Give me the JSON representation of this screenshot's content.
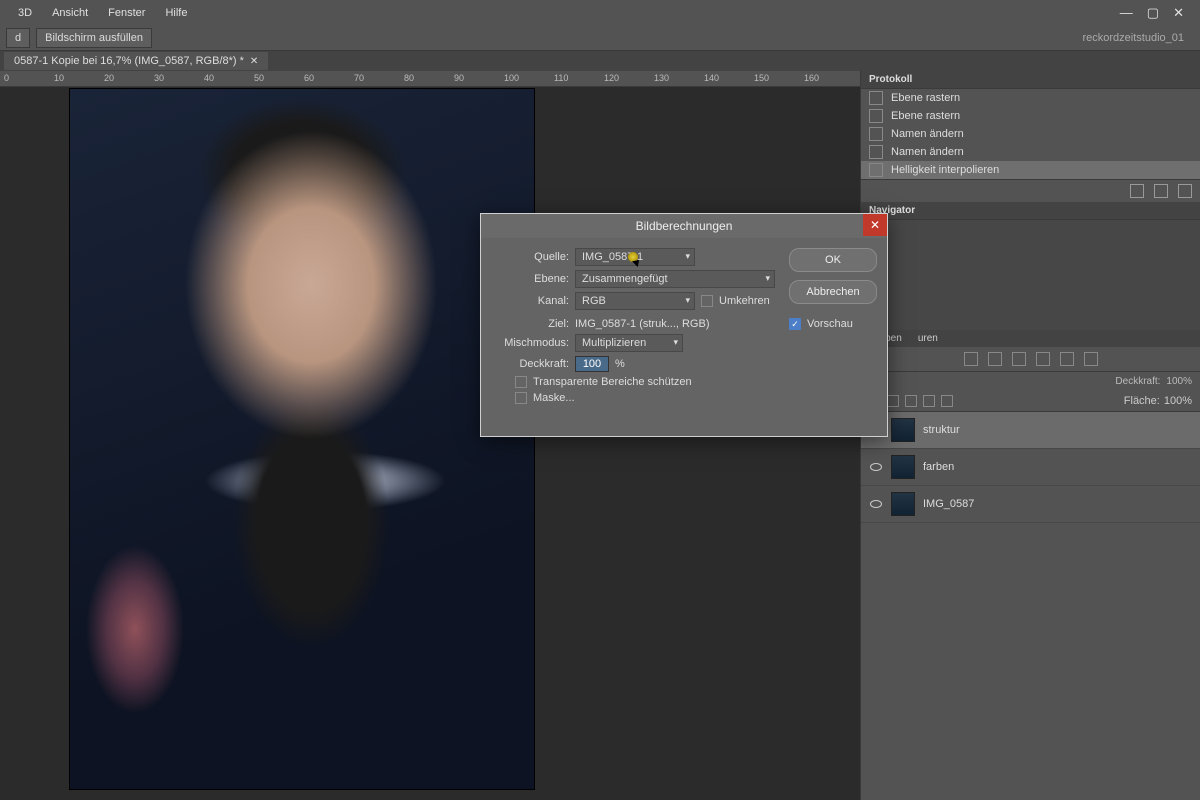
{
  "menubar": {
    "items": [
      "3D",
      "Ansicht",
      "Fenster",
      "Hilfe"
    ]
  },
  "options": {
    "left_btn": "d",
    "fill_btn": "Bildschirm ausfüllen",
    "workspace": "reckordzeitstudio_01"
  },
  "document_tab": "0587-1 Kopie bei 16,7% (IMG_0587, RGB/8*) *",
  "ruler_marks": [
    "0",
    "10",
    "20",
    "30",
    "40",
    "50",
    "60",
    "70",
    "80",
    "90",
    "100",
    "110",
    "120",
    "130",
    "140",
    "150",
    "160"
  ],
  "dialog": {
    "title": "Bildberechnungen",
    "labels": {
      "quelle": "Quelle:",
      "ebene": "Ebene:",
      "kanal": "Kanal:",
      "umkehren": "Umkehren",
      "ziel": "Ziel:",
      "mischmodus": "Mischmodus:",
      "deckkraft": "Deckkraft:",
      "percent": "%",
      "transp": "Transparente Bereiche schützen",
      "maske": "Maske...",
      "ok": "OK",
      "abbrechen": "Abbrechen",
      "vorschau": "Vorschau"
    },
    "values": {
      "quelle": "IMG_0587-1",
      "ebene": "Zusammengefügt",
      "kanal": "RGB",
      "ziel": "IMG_0587-1 (struk..., RGB)",
      "mischmodus": "Multiplizieren",
      "deckkraft": "100"
    }
  },
  "history": {
    "title": "Protokoll",
    "items": [
      "Ebene rastern",
      "Ebene rastern",
      "Namen ändern",
      "Namen ändern",
      "Helligkeit interpolieren"
    ]
  },
  "navigator": {
    "title": "Navigator"
  },
  "layers": {
    "tabs": [
      "vgaben",
      "uren"
    ],
    "opacity_label": "Deckkraft:",
    "opacity_value": "100%",
    "fill_label": "Fläche:",
    "fill_value": "100%",
    "items": [
      {
        "name": "struktur"
      },
      {
        "name": "farben"
      },
      {
        "name": "IMG_0587"
      }
    ]
  }
}
